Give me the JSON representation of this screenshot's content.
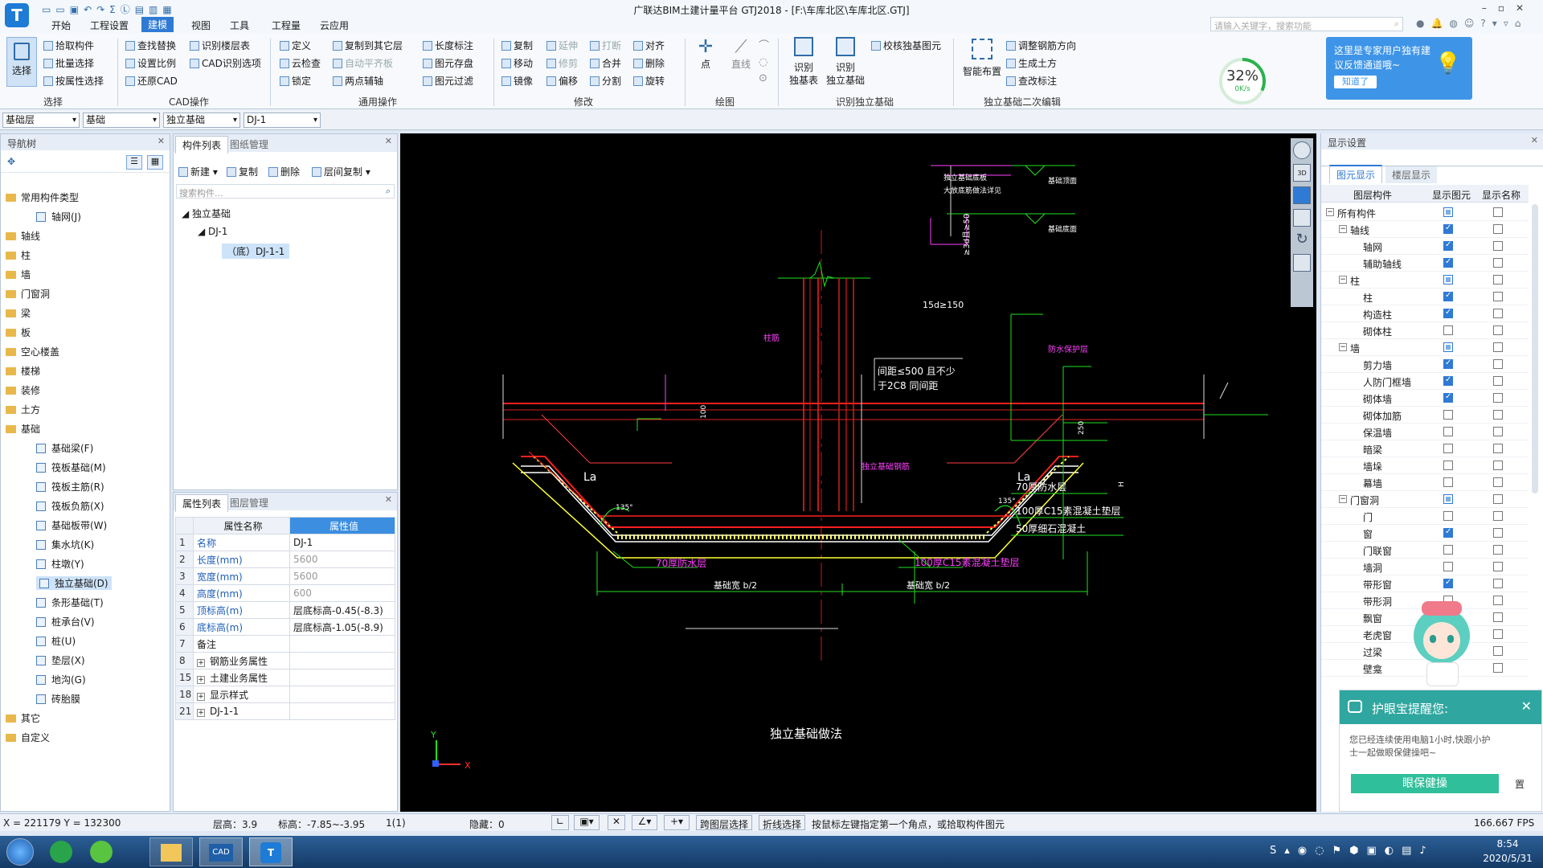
{
  "window": {
    "title": "广联达BIM土建计量平台 GTJ2018 - [F:\\车库北区\\车库北区.GTJ]"
  },
  "menu": [
    "开始",
    "工程设置",
    "建模",
    "视图",
    "工具",
    "工程量",
    "云应用"
  ],
  "search_placeholder": "请输入关键字，搜索功能",
  "ribbon": {
    "select": {
      "big": "选择",
      "items": [
        "拾取构件",
        "批量选择",
        "按属性选择"
      ],
      "group": "选择"
    },
    "cad": {
      "items": [
        "查找替换",
        "设置比例",
        "还原CAD",
        "识别楼层表",
        "CAD识别选项"
      ],
      "group": "CAD操作"
    },
    "common": {
      "items": [
        "定义",
        "云检查",
        "锁定",
        "复制到其它层",
        "自动平齐板",
        "两点辅轴",
        "长度标注",
        "图元存盘",
        "图元过滤"
      ],
      "group": "通用操作"
    },
    "modify": {
      "items": [
        "复制",
        "移动",
        "镜像",
        "延伸",
        "修剪",
        "偏移",
        "打断",
        "合并",
        "分割",
        "对齐",
        "删除",
        "旋转"
      ],
      "group": "修改"
    },
    "draw": {
      "items": [
        "点",
        "直线"
      ],
      "group": "绘图"
    },
    "recog": {
      "items": [
        "识别独基表",
        "识别独立基础",
        "校核独基图元"
      ],
      "group": "识别独立基础"
    },
    "edit2": {
      "items": [
        "智能布置",
        "调整钢筋方向",
        "生成土方",
        "查改标注"
      ],
      "group": "独立基础二次编辑"
    }
  },
  "speed": {
    "percent": "32%",
    "rate": "0K/s",
    "value": 0.32
  },
  "tip": {
    "text": "这里是专家用户独有建议反馈通道哦~",
    "button": "知道了"
  },
  "combos": [
    "基础层",
    "基础",
    "独立基础",
    "DJ-1"
  ],
  "nav": {
    "title": "导航树",
    "items": [
      "常用构件类型",
      "轴网(J)",
      "轴线",
      "柱",
      "墙",
      "门窗洞",
      "梁",
      "板",
      "空心楼盖",
      "楼梯",
      "装修",
      "土方",
      "基础",
      "基础梁(F)",
      "筏板基础(M)",
      "筏板主筋(R)",
      "筏板负筋(X)",
      "基础板带(W)",
      "集水坑(K)",
      "柱墩(Y)",
      "独立基础(D)",
      "条形基础(T)",
      "桩承台(V)",
      "桩(U)",
      "垫层(X)",
      "地沟(G)",
      "砖胎膜",
      "其它",
      "自定义"
    ]
  },
  "comp": {
    "tabs": [
      "构件列表",
      "图纸管理"
    ],
    "toolbar": [
      "新建",
      "复制",
      "删除",
      "层间复制"
    ],
    "search": "搜索构件...",
    "tree": [
      "独立基础",
      "DJ-1",
      "（底）DJ-1-1"
    ]
  },
  "props": {
    "tabs": [
      "属性列表",
      "图层管理"
    ],
    "headers": [
      "属性名称",
      "属性值"
    ],
    "rows": [
      [
        "1",
        "名称",
        "DJ-1"
      ],
      [
        "2",
        "长度(mm)",
        "5600"
      ],
      [
        "3",
        "宽度(mm)",
        "5600"
      ],
      [
        "4",
        "高度(mm)",
        "600"
      ],
      [
        "5",
        "顶标高(m)",
        "层底标高-0.45(-8.3)"
      ],
      [
        "6",
        "底标高(m)",
        "层底标高-1.05(-8.9)"
      ],
      [
        "7",
        "备注",
        ""
      ],
      [
        "8",
        "钢筋业务属性",
        ""
      ],
      [
        "15",
        "土建业务属性",
        ""
      ],
      [
        "18",
        "显示样式",
        ""
      ],
      [
        "21",
        "DJ-1-1",
        ""
      ]
    ]
  },
  "cad_text": {
    "la1": "La",
    "la2": "La",
    "t135a": "135°",
    "t135b": "135°",
    "n100": "100",
    "n250": "250",
    "nh": "H",
    "spacing1": "间距≤500 且不少",
    "spacing2": "于2C8 同间距",
    "rows70a": "70厚防水层",
    "rows100": "100厚C15素混凝土垫层",
    "rows70b": "70厚防水层",
    "rows50": "50厚细石混凝土",
    "half1": "基础宽 b/2",
    "half2": "基础宽 b/2",
    "dim15": "15d≥150",
    "dim3": "≥3d且≥50",
    "r1": "独立基础底板",
    "r2": "大放底筋做法详见",
    "r3": "基础顶面",
    "r4": "基础底面",
    "col": "柱筋",
    "red1": "独立基础钢筋",
    "magenta1": "防水保护层",
    "title": "独立基础做法",
    "axisY": "Y",
    "axisX": "X"
  },
  "display": {
    "title": "显示设置",
    "tabs": [
      "图元显示",
      "楼层显示"
    ],
    "headers": [
      "图层构件",
      "显示图元",
      "显示名称"
    ],
    "rows": [
      [
        "所有构件",
        "part",
        false,
        0
      ],
      [
        "轴线",
        "on",
        false,
        1
      ],
      [
        "轴网",
        "on",
        false,
        2
      ],
      [
        "辅助轴线",
        "on",
        false,
        2
      ],
      [
        "柱",
        "part",
        false,
        1
      ],
      [
        "柱",
        "on",
        false,
        2
      ],
      [
        "构造柱",
        "on",
        false,
        2
      ],
      [
        "砌体柱",
        "off",
        false,
        2
      ],
      [
        "墙",
        "part",
        false,
        1
      ],
      [
        "剪力墙",
        "on",
        false,
        2
      ],
      [
        "人防门框墙",
        "on",
        false,
        2
      ],
      [
        "砌体墙",
        "on",
        false,
        2
      ],
      [
        "砌体加筋",
        "off",
        false,
        2
      ],
      [
        "保温墙",
        "off",
        false,
        2
      ],
      [
        "暗梁",
        "off",
        false,
        2
      ],
      [
        "墙垛",
        "off",
        false,
        2
      ],
      [
        "幕墙",
        "off",
        false,
        2
      ],
      [
        "门窗洞",
        "part",
        false,
        1
      ],
      [
        "门",
        "off",
        false,
        2
      ],
      [
        "窗",
        "on",
        false,
        2
      ],
      [
        "门联窗",
        "off",
        false,
        2
      ],
      [
        "墙洞",
        "off",
        false,
        2
      ],
      [
        "带形窗",
        "on",
        false,
        2
      ],
      [
        "带形洞",
        "off",
        false,
        2
      ],
      [
        "飘窗",
        "off",
        false,
        2
      ],
      [
        "老虎窗",
        "off",
        false,
        2
      ],
      [
        "过梁",
        "off",
        false,
        2
      ],
      [
        "壁龛",
        "off",
        false,
        2
      ]
    ]
  },
  "eyecare": {
    "title": "护眼宝提醒您:",
    "body": "您已经连续使用电脑1小时,快跟小护士一起做眼保健操吧~",
    "button": "眼保健操",
    "side": "置"
  },
  "status": {
    "coords": "X = 221179 Y = 132300",
    "floor_h": "层高：3.9",
    "elev": "标高：-7.85~-3.95",
    "count": "1(1)",
    "hidden": "隐藏：0",
    "btn1": "跨图层选择",
    "btn2": "折线选择",
    "hint": "按鼠标左键指定第一个角点，或拾取构件图元",
    "fps": "166.667 FPS"
  },
  "taskbar": {
    "time": "8:54",
    "date": "2020/5/31"
  }
}
